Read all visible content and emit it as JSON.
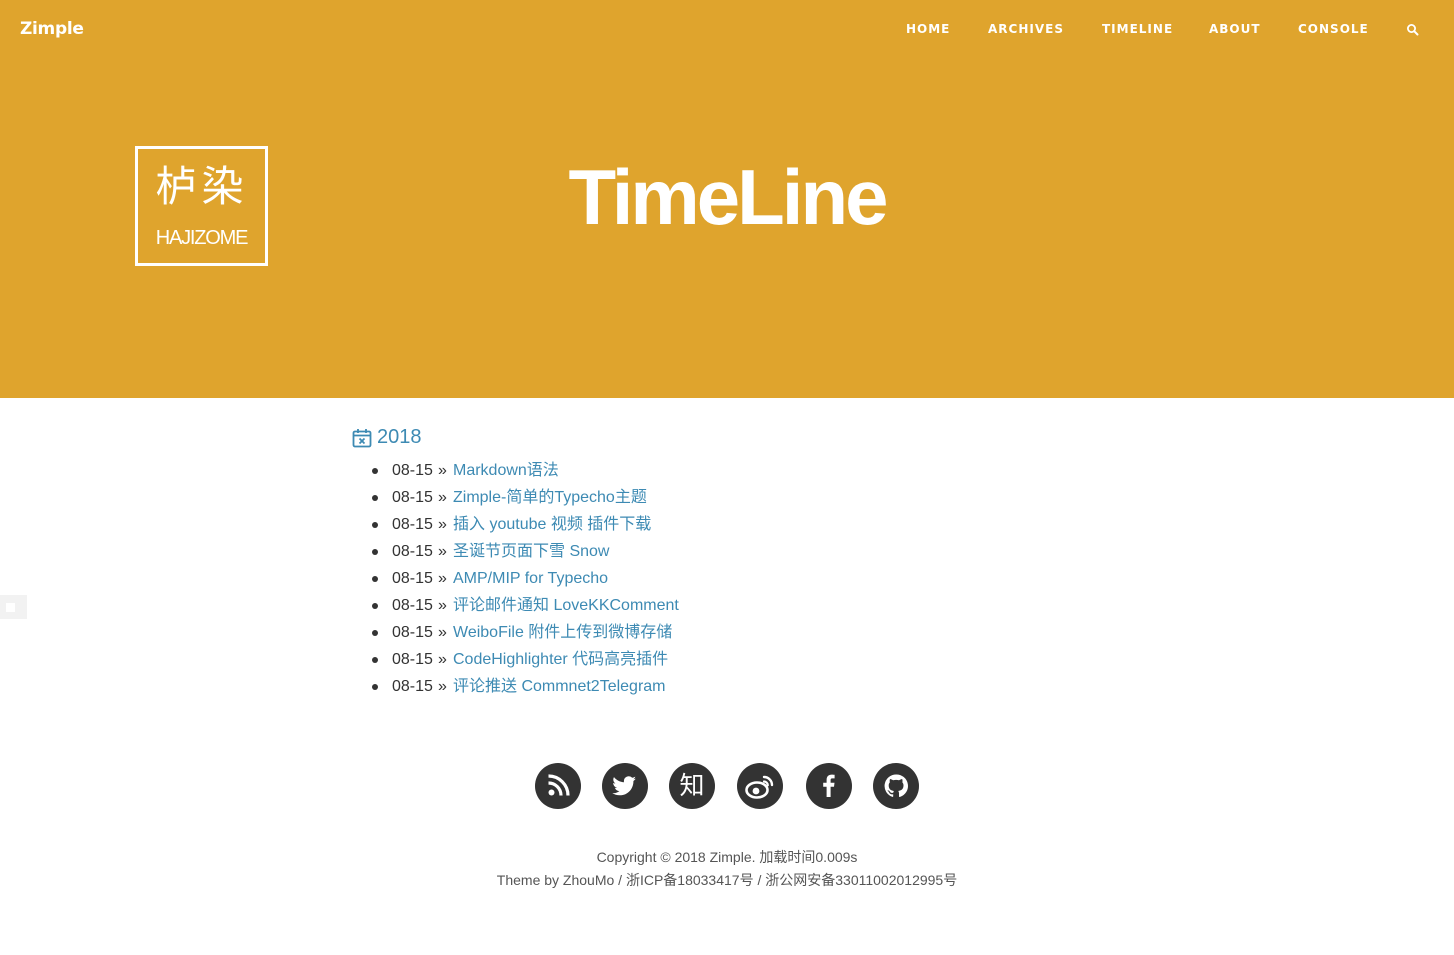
{
  "header": {
    "brand": "Zimple",
    "nav": [
      "HOME",
      "ARCHIVES",
      "TIMELINE",
      "ABOUT",
      "CONSOLE"
    ],
    "search_icon": "search-icon"
  },
  "colors": {
    "hero_background": "#dfa42d",
    "link": "#3d8ab3",
    "text": "#333333",
    "social_background": "#333333"
  },
  "logo": {
    "chinese": "栌染",
    "english": "HAJIZOME"
  },
  "hero": {
    "title": "TimeLine"
  },
  "timeline": {
    "year_icon": "calendar-x-icon",
    "year": "2018",
    "separator": "»",
    "posts": [
      {
        "date": "08-15",
        "title": "Markdown语法"
      },
      {
        "date": "08-15",
        "title": "Zimple-简单的Typecho主题"
      },
      {
        "date": "08-15",
        "title": "插入 youtube 视频 插件下载"
      },
      {
        "date": "08-15",
        "title": "圣诞节页面下雪 Snow"
      },
      {
        "date": "08-15",
        "title": "AMP/MIP for Typecho"
      },
      {
        "date": "08-15",
        "title": "评论邮件通知 LoveKKComment"
      },
      {
        "date": "08-15",
        "title": "WeiboFile 附件上传到微博存储"
      },
      {
        "date": "08-15",
        "title": "CodeHighlighter 代码高亮插件"
      },
      {
        "date": "08-15",
        "title": "评论推送 Commnet2Telegram"
      }
    ]
  },
  "social": {
    "icons": [
      "rss-icon",
      "twitter-icon",
      "zhihu-icon",
      "weibo-icon",
      "facebook-icon",
      "github-icon"
    ],
    "zhihu_glyph": "知"
  },
  "footer": {
    "copyright": "Copyright © 2018 Zimple. 加载时间0.009s",
    "theme": "Theme by ZhouMo / 浙ICP备18033417号 / 浙公网安备33011002012995号"
  }
}
